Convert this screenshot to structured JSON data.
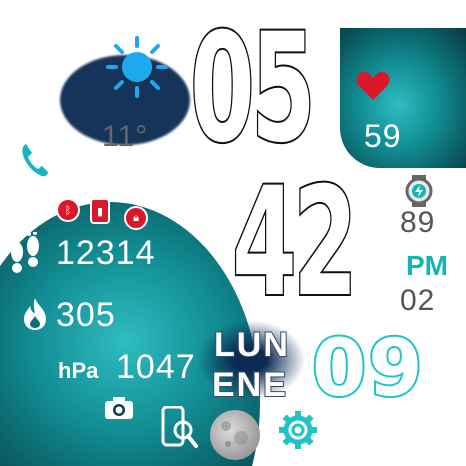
{
  "time": {
    "hour": "05",
    "minute": "42",
    "ampm": "PM",
    "seconds": "02"
  },
  "weather": {
    "icon": "sun-cloud-icon",
    "temperature": "11°"
  },
  "heart_rate": {
    "icon": "heart-icon",
    "value": "59"
  },
  "battery": {
    "icon": "watch-charging-icon",
    "value": "89"
  },
  "steps": {
    "icon": "footsteps-icon",
    "value": "12314"
  },
  "calories": {
    "icon": "flame-icon",
    "value": "305"
  },
  "pressure": {
    "label": "hPa",
    "value": "1047"
  },
  "date": {
    "weekday": "LUN",
    "month": "ENE",
    "day": "09"
  },
  "status_icons": [
    "bluetooth-icon",
    "battery-status-icon",
    "lock-icon"
  ],
  "shortcuts": [
    "phone-icon",
    "camera-icon",
    "find-phone-icon",
    "moon-phase-icon",
    "settings-icon"
  ],
  "colors": {
    "accent": "#1fc4c8",
    "heart": "#d9182a",
    "ampm": "#14b3b8",
    "panel": "#0d7077"
  }
}
